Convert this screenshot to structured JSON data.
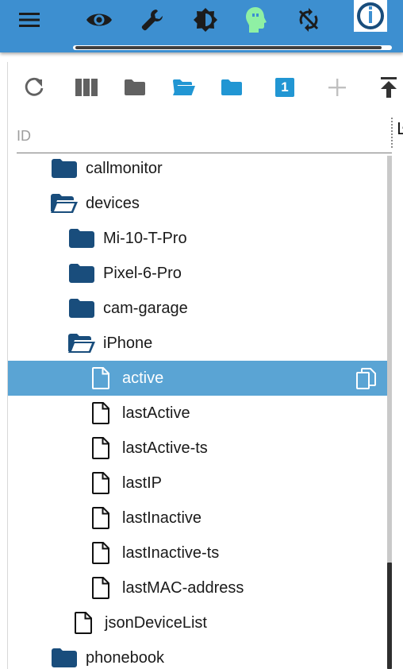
{
  "app": {
    "logo_alt": "ioBroker"
  },
  "topbar_icons": [
    "menu-icon",
    "eye-icon",
    "wrench-icon",
    "brightness-icon",
    "expert-mode-head-icon",
    "sync-off-icon"
  ],
  "colors": {
    "topbar": "#3d8fd0",
    "folder": "#194d7c",
    "toolbar_dark": "#616161",
    "toolbar_blue": "#2196d3",
    "selected_row": "#5aa4d4",
    "expert_head": "#8ff0a4"
  },
  "toolbar": {
    "buttons": [
      "refresh-icon",
      "columns-icon",
      "folder-closed-icon",
      "folder-open-icon",
      "folder-blue-icon",
      "level-badge",
      "add-icon",
      "collapse-top-icon"
    ],
    "level_badge": "1"
  },
  "filter": {
    "placeholder": "ID",
    "value": ""
  },
  "column_cut_text": "Ŀ",
  "tree": [
    {
      "label": "callmonitor",
      "type": "folder",
      "open": false
    },
    {
      "label": "devices",
      "type": "folder",
      "open": true
    },
    {
      "label": "Mi-10-T-Pro",
      "type": "folder",
      "open": false
    },
    {
      "label": "Pixel-6-Pro",
      "type": "folder",
      "open": false
    },
    {
      "label": "cam-garage",
      "type": "folder",
      "open": false
    },
    {
      "label": "iPhone",
      "type": "folder",
      "open": true
    },
    {
      "label": "active",
      "type": "state",
      "selected": true
    },
    {
      "label": "lastActive",
      "type": "state"
    },
    {
      "label": "lastActive-ts",
      "type": "state"
    },
    {
      "label": "lastIP",
      "type": "state"
    },
    {
      "label": "lastInactive",
      "type": "state"
    },
    {
      "label": "lastInactive-ts",
      "type": "state"
    },
    {
      "label": "lastMAC-address",
      "type": "state"
    },
    {
      "label": "jsonDeviceList",
      "type": "state"
    },
    {
      "label": "phonebook",
      "type": "folder",
      "open": false
    }
  ]
}
